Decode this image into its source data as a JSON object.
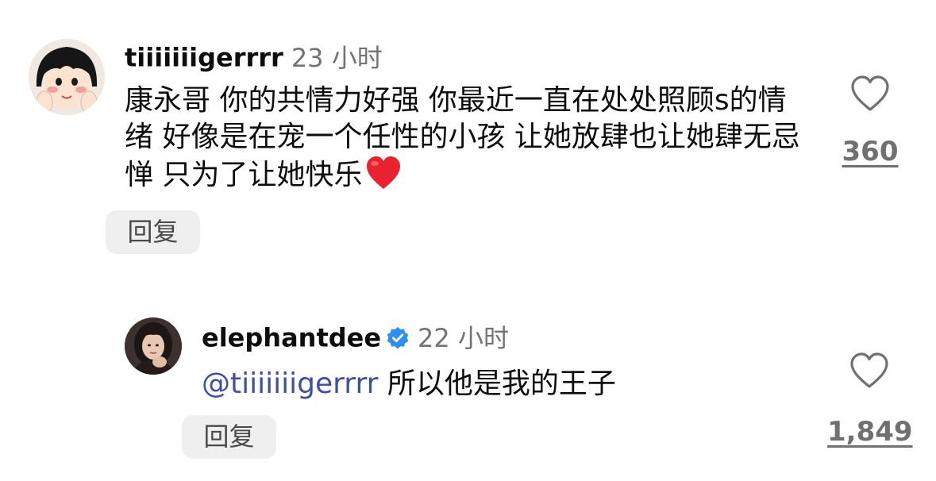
{
  "comments": [
    {
      "username": "tiiiiiiigerrrr",
      "time": "23 小时",
      "text": "康永哥 你的共情力好强 你最近一直在处处照顾s的情绪 好像是在宠一个任性的小孩 让她放肆也让她肆无忌惮 只为了让她快乐",
      "emoji": "red-heart",
      "reply_label": "回复",
      "like_count": "360",
      "avatar_icon": "cartoon-girl-avatar"
    },
    {
      "username": "elephantdee",
      "verified": true,
      "time": "22 小时",
      "mention": "@tiiiiiiigerrrr",
      "text": "所以他是我的王子",
      "reply_label": "回复",
      "like_count": "1,849",
      "avatar_icon": "profile-photo-avatar"
    }
  ],
  "colors": {
    "mention": "#3d4fa6",
    "secondary_text": "#737373",
    "verified_badge": "#2f8ff0",
    "reply_button_bg": "#efefef",
    "emoji_heart": "#e8232f"
  }
}
